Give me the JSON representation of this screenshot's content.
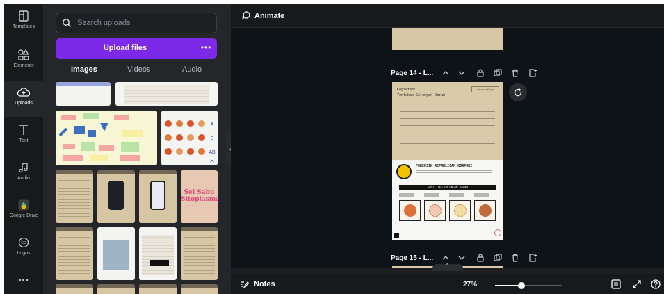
{
  "rail": {
    "items": [
      {
        "label": "Templates",
        "icon": "templates-icon"
      },
      {
        "label": "Elements",
        "icon": "elements-icon"
      },
      {
        "label": "Uploads",
        "icon": "uploads-icon",
        "active": true
      },
      {
        "label": "Text",
        "icon": "text-icon"
      },
      {
        "label": "Audio",
        "icon": "audio-icon"
      },
      {
        "label": "Google Drive",
        "icon": "google-drive-icon"
      },
      {
        "label": "Logos",
        "icon": "logos-icon"
      }
    ],
    "more": "•••"
  },
  "panel": {
    "search_placeholder": "Search uploads",
    "upload_label": "Upload files",
    "upload_more": "•••",
    "tabs": [
      {
        "label": "Images",
        "active": true
      },
      {
        "label": "Videos"
      },
      {
        "label": "Audio"
      }
    ],
    "pink_thumb_text": "Sel Sabu Sitoplasma"
  },
  "editor": {
    "animate_label": "Animate",
    "page14_title": "Page 14 - L...",
    "page15_title": "Page 15 - L...",
    "page": {
      "label": "Kegiatan:",
      "sub": "Tentukan Golongan Darah",
      "stamp": "Lembar Kerja",
      "org": "FORENSIK REPUBLICAN KORPORI",
      "bar": "HASIL TES GOLONGAN DARAH"
    }
  },
  "bottom": {
    "notes_label": "Notes",
    "zoom_label": "27%",
    "zoom_value": 0.27
  },
  "colors": {
    "accent": "#7d2ae8",
    "rail_bg": "#18191b",
    "panel_bg": "#252629",
    "canvas_bg": "#0e1318",
    "page_bg": "#d8c9a8"
  }
}
